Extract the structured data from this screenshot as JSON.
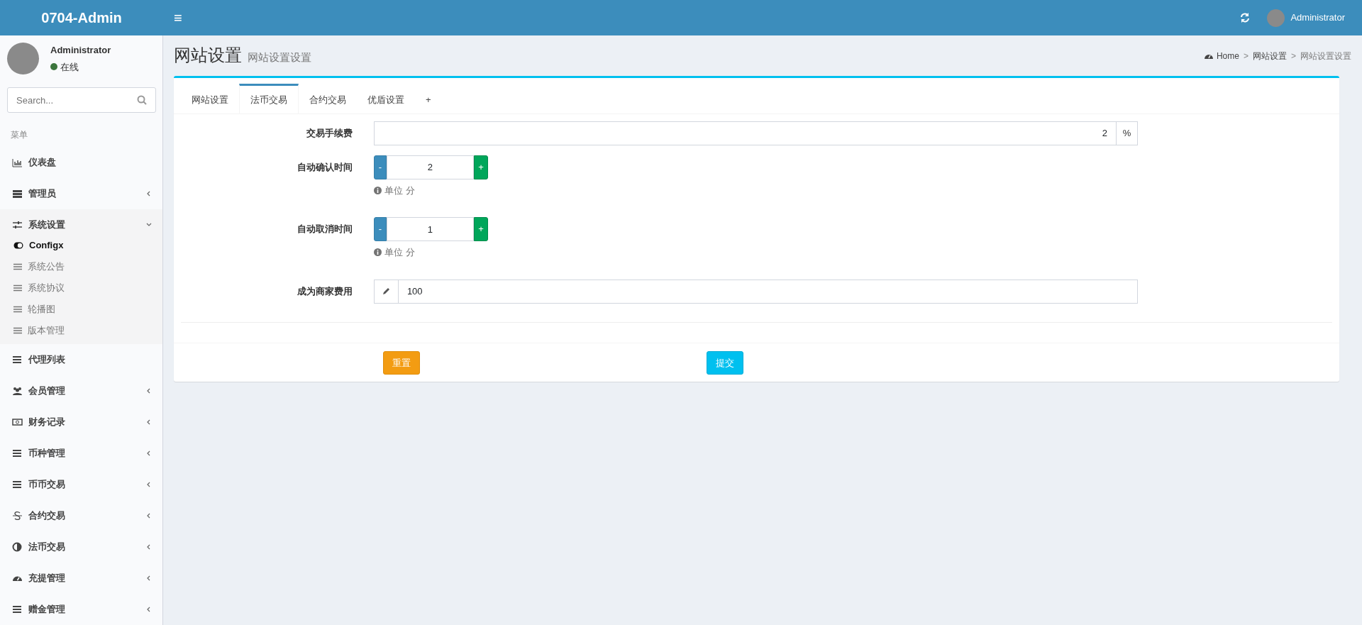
{
  "header": {
    "logo": "0704-Admin",
    "toggle": "≡",
    "user": "Administrator"
  },
  "sidebar": {
    "user": {
      "name": "Administrator",
      "status": "在线",
      "online": true
    },
    "search": {
      "placeholder": "Search..."
    },
    "menu_header": "菜单",
    "items": [
      {
        "label": "仪表盘",
        "has_submenu": false
      },
      {
        "label": "管理员",
        "has_submenu": true,
        "expanded": false
      },
      {
        "label": "系统设置",
        "has_submenu": true,
        "expanded": true,
        "children": [
          {
            "label": "Configx",
            "selected": true
          },
          {
            "label": "系统公告",
            "selected": false
          },
          {
            "label": "系统协议",
            "selected": false
          },
          {
            "label": "轮播图",
            "selected": false
          },
          {
            "label": "版本管理",
            "selected": false
          }
        ]
      },
      {
        "label": "代理列表",
        "has_submenu": false
      },
      {
        "label": "会员管理",
        "has_submenu": true,
        "expanded": false
      },
      {
        "label": "财务记录",
        "has_submenu": true,
        "expanded": false
      },
      {
        "label": "币种管理",
        "has_submenu": true,
        "expanded": false
      },
      {
        "label": "币币交易",
        "has_submenu": true,
        "expanded": false
      },
      {
        "label": "合约交易",
        "has_submenu": true,
        "expanded": false
      },
      {
        "label": "法币交易",
        "has_submenu": true,
        "expanded": false
      },
      {
        "label": "充提管理",
        "has_submenu": true,
        "expanded": false
      },
      {
        "label": "赠金管理",
        "has_submenu": true,
        "expanded": false
      }
    ]
  },
  "page": {
    "title": "网站设置",
    "subtitle": "网站设置设置",
    "breadcrumb": [
      {
        "label": "Home"
      },
      {
        "separator": ">",
        "label": "网站设置"
      },
      {
        "separator": ">",
        "label": "网站设置设置"
      }
    ],
    "tabs": [
      {
        "label": "网站设置",
        "selected": false
      },
      {
        "label": "法币交易",
        "selected": true
      },
      {
        "label": "合约交易",
        "selected": false
      },
      {
        "label": "优盾设置",
        "selected": false
      },
      {
        "label": "+",
        "selected": false
      }
    ],
    "fields": [
      {
        "kind": "suffix",
        "label": "交易手续费",
        "value": "2",
        "suffix": "%"
      },
      {
        "kind": "stepper",
        "label": "自动确认时间",
        "value": "2",
        "minus": "-",
        "plus": "+",
        "help": "单位 分"
      },
      {
        "kind": "stepper",
        "label": "自动取消时间",
        "value": "1",
        "minus": "-",
        "plus": "+",
        "help": "单位 分"
      },
      {
        "kind": "prefix_icon",
        "label": "成为商家费用",
        "value": "100"
      }
    ],
    "buttons": [
      {
        "kind": "reset",
        "label": "重置"
      },
      {
        "kind": "submit",
        "label": "提交"
      }
    ]
  }
}
